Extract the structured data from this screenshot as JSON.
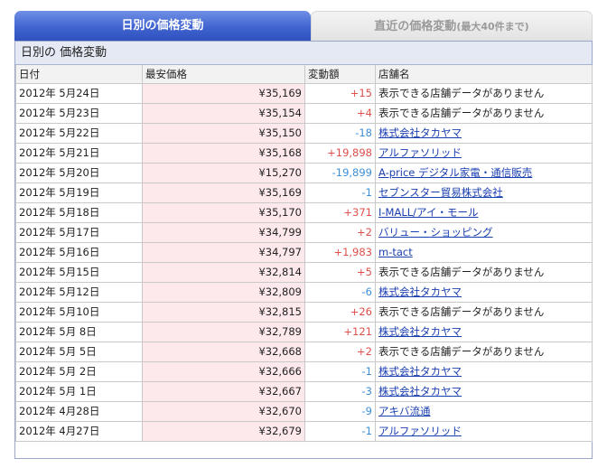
{
  "tabs": {
    "daily": "日別の価格変動",
    "recent": "直近の価格変動",
    "recent_note": "(最大40件まで)"
  },
  "panel_title": "日別の 価格変動",
  "columns": [
    "日付",
    "最安価格",
    "変動額",
    "店舗名"
  ],
  "rows": [
    {
      "date": "2012年 5月24日",
      "price": "¥35,169",
      "change": "+15",
      "dir": "up",
      "shop": "表示できる店舗データがありません",
      "link": false
    },
    {
      "date": "2012年 5月23日",
      "price": "¥35,154",
      "change": "+4",
      "dir": "up",
      "shop": "表示できる店舗データがありません",
      "link": false
    },
    {
      "date": "2012年 5月22日",
      "price": "¥35,150",
      "change": "-18",
      "dir": "down",
      "shop": "株式会社タカヤマ",
      "link": true
    },
    {
      "date": "2012年 5月21日",
      "price": "¥35,168",
      "change": "+19,898",
      "dir": "up",
      "shop": "アルファソリッド",
      "link": true
    },
    {
      "date": "2012年 5月20日",
      "price": "¥15,270",
      "change": "-19,899",
      "dir": "down",
      "shop": "A-price デジタル家電・通信販売",
      "link": true
    },
    {
      "date": "2012年 5月19日",
      "price": "¥35,169",
      "change": "-1",
      "dir": "down",
      "shop": "セブンスター貿易株式会社",
      "link": true
    },
    {
      "date": "2012年 5月18日",
      "price": "¥35,170",
      "change": "+371",
      "dir": "up",
      "shop": "I-MALL/アイ・モール",
      "link": true
    },
    {
      "date": "2012年 5月17日",
      "price": "¥34,799",
      "change": "+2",
      "dir": "up",
      "shop": "バリュー・ショッピング",
      "link": true
    },
    {
      "date": "2012年 5月16日",
      "price": "¥34,797",
      "change": "+1,983",
      "dir": "up",
      "shop": "m-tact",
      "link": true
    },
    {
      "date": "2012年 5月15日",
      "price": "¥32,814",
      "change": "+5",
      "dir": "up",
      "shop": "表示できる店舗データがありません",
      "link": false
    },
    {
      "date": "2012年 5月12日",
      "price": "¥32,809",
      "change": "-6",
      "dir": "down",
      "shop": "株式会社タカヤマ",
      "link": true
    },
    {
      "date": "2012年 5月10日",
      "price": "¥32,815",
      "change": "+26",
      "dir": "up",
      "shop": "表示できる店舗データがありません",
      "link": false
    },
    {
      "date": "2012年 5月 8日",
      "price": "¥32,789",
      "change": "+121",
      "dir": "up",
      "shop": "株式会社タカヤマ",
      "link": true
    },
    {
      "date": "2012年 5月 5日",
      "price": "¥32,668",
      "change": "+2",
      "dir": "up",
      "shop": "表示できる店舗データがありません",
      "link": false
    },
    {
      "date": "2012年 5月 2日",
      "price": "¥32,666",
      "change": "-1",
      "dir": "down",
      "shop": "株式会社タカヤマ",
      "link": true
    },
    {
      "date": "2012年 5月 1日",
      "price": "¥32,667",
      "change": "-3",
      "dir": "down",
      "shop": "株式会社タカヤマ",
      "link": true
    },
    {
      "date": "2012年 4月28日",
      "price": "¥32,670",
      "change": "-9",
      "dir": "down",
      "shop": "アキバ流通",
      "link": true
    },
    {
      "date": "2012年 4月27日",
      "price": "¥32,679",
      "change": "-1",
      "dir": "down",
      "shop": "アルファソリッド",
      "link": true
    }
  ],
  "colors": {
    "up": "#e0504b",
    "down": "#3e8fd8",
    "link": "#1a3fb0",
    "price_bg": "#fde9ec",
    "tab_active": "#3f63cf"
  }
}
